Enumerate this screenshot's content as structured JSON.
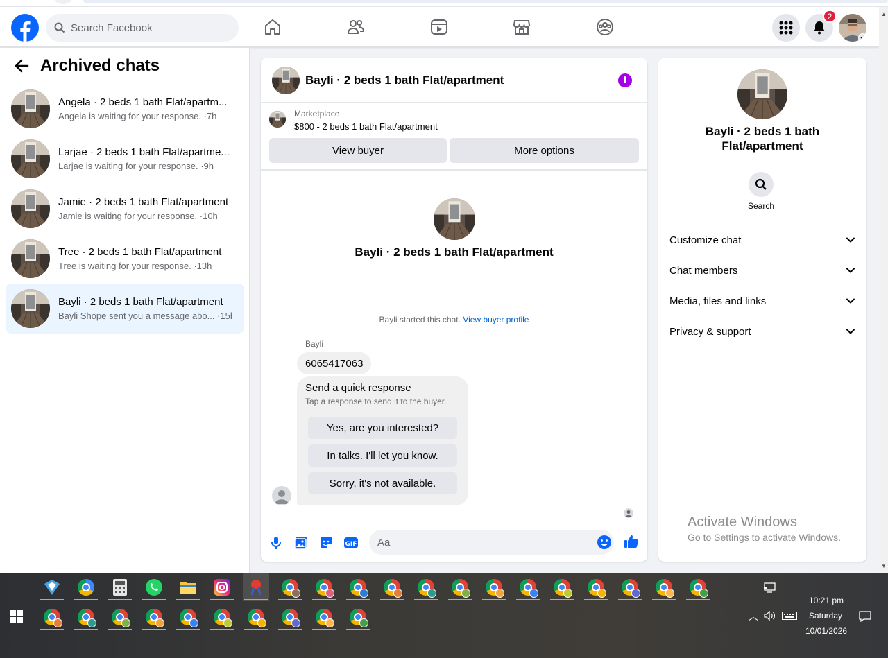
{
  "header": {
    "search_placeholder": "Search Facebook",
    "notification_count": "2"
  },
  "left": {
    "title": "Archived chats",
    "chats": [
      {
        "name": "Angela · 2 beds 1 bath Flat/apartm...",
        "sub": "Angela is waiting for your response. ·7h"
      },
      {
        "name": "Larjae · 2 beds 1 bath Flat/apartme...",
        "sub": "Larjae is waiting for your response. ·9h"
      },
      {
        "name": "Jamie · 2 beds 1 bath Flat/apartment",
        "sub": "Jamie is waiting for your response. ·10h"
      },
      {
        "name": "Tree · 2 beds 1 bath Flat/apartment",
        "sub": "Tree is waiting for your response. ·13h"
      },
      {
        "name": "Bayli · 2 beds 1 bath Flat/apartment",
        "sub": "Bayli Shope sent you a message abo... ·15h"
      }
    ]
  },
  "conversation": {
    "title": "Bayli · 2 beds 1 bath Flat/apartment",
    "marketplace_label": "Marketplace",
    "listing": "$800 - 2 beds 1 bath Flat/apartment",
    "view_buyer": "View buyer",
    "more_options": "More options",
    "center_title": "Bayli · 2 beds 1 bath Flat/apartment",
    "started_text": "Bayli started this chat.",
    "view_profile": "View buyer profile",
    "sender": "Bayli",
    "message": "6065417063",
    "quick_title": "Send a quick response",
    "quick_sub": "Tap a response to send it to the buyer.",
    "quick_responses": [
      "Yes, are you interested?",
      "In talks. I'll let you know.",
      "Sorry, it's not available."
    ],
    "input_placeholder": "Aa"
  },
  "info": {
    "name": "Bayli · 2 beds 1 bath Flat/apartment",
    "search_label": "Search",
    "sections": [
      "Customize chat",
      "Chat members",
      "Media, files and links",
      "Privacy & support"
    ]
  },
  "watermark": {
    "line1": "Activate Windows",
    "line2": "Go to Settings to activate Windows."
  },
  "taskbar": {
    "time": "10:21 pm",
    "day": "Saturday",
    "date": "10/01/2026"
  },
  "colors": {
    "fb_blue": "#0866ff",
    "messenger_purple": "#a300e6",
    "active_chat": "#ebf5ff",
    "badge_red": "#e41e3f"
  }
}
